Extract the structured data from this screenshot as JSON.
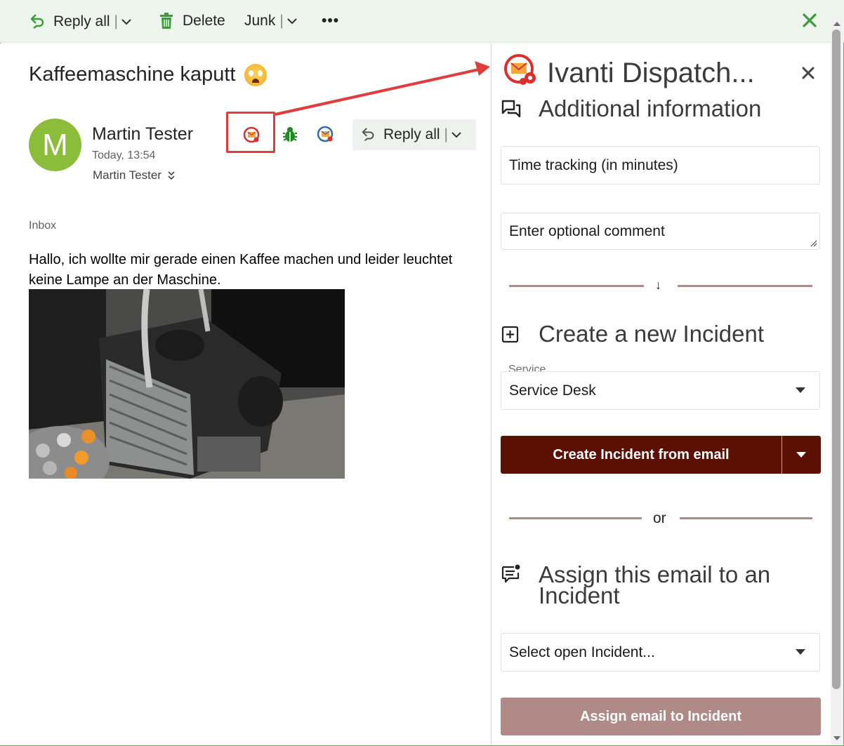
{
  "toolbar": {
    "reply_all": "Reply all",
    "delete": "Delete",
    "junk": "Junk",
    "more": "•••"
  },
  "message": {
    "subject": "Kaffeemaschine kaputt",
    "avatar_initial": "M",
    "sender": "Martin Tester",
    "time": "Today, 13:54",
    "to": "Martin Tester",
    "reply_all": "Reply all",
    "folder": "Inbox",
    "body": "Hallo, ich wollte mir gerade einen Kaffee machen und leider leuchtet keine Lampe an der Maschine."
  },
  "pane": {
    "title": "Ivanti Dispatch...",
    "additional_info": "Additional information",
    "time_tracking": "Time tracking (in minutes)",
    "comment_placeholder": "Enter optional comment",
    "divider_arrow": "↓",
    "create_heading": "Create a new Incident",
    "service_label": "Service",
    "service_value": "Service Desk",
    "create_button": "Create Incident from email",
    "or": "or",
    "assign_heading": "Assign this email to an Incident",
    "select_incident": "Select open Incident...",
    "assign_button": "Assign email to Incident"
  },
  "colors": {
    "primary": "#5c1003",
    "disabled": "#b08a87",
    "accent_green": "#3a9c3a",
    "highlight_red": "#e03c3c"
  },
  "icons": [
    "reply-all-icon",
    "trash-icon",
    "chevron-down-icon",
    "more-icon",
    "close-icon",
    "ivanti-addin-icon",
    "bug-icon",
    "gear-envelope-icon",
    "comments-icon",
    "plus-square-icon",
    "assign-message-icon"
  ]
}
